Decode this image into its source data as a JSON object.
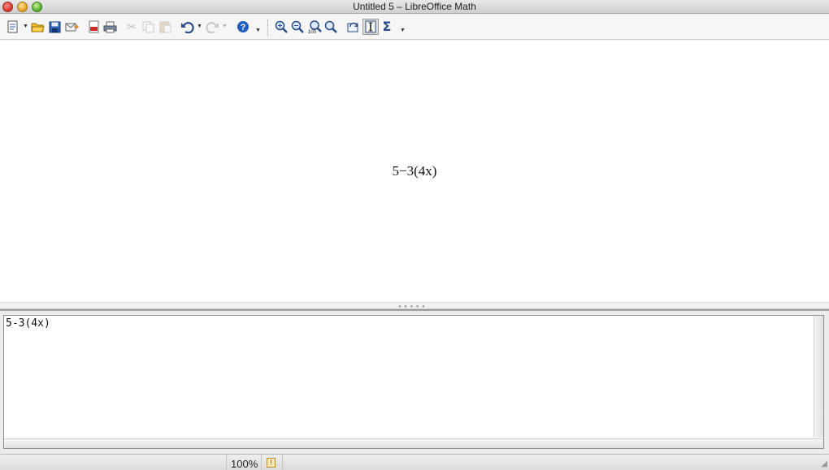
{
  "window": {
    "title": "Untitled 5 – LibreOffice Math"
  },
  "toolbar": {
    "buttons": [
      {
        "name": "new-document",
        "icon": "new-document-icon"
      },
      {
        "name": "open",
        "icon": "folder-open-icon"
      },
      {
        "name": "save",
        "icon": "floppy-disk-icon"
      },
      {
        "name": "email",
        "icon": "email-icon"
      },
      {
        "name": "export-pdf",
        "icon": "pdf-icon"
      },
      {
        "name": "print",
        "icon": "printer-icon"
      },
      {
        "name": "cut",
        "icon": "scissors-icon",
        "disabled": true
      },
      {
        "name": "copy",
        "icon": "copy-icon",
        "disabled": true
      },
      {
        "name": "paste",
        "icon": "paste-icon",
        "disabled": true
      },
      {
        "name": "undo",
        "icon": "undo-icon"
      },
      {
        "name": "redo",
        "icon": "redo-icon",
        "disabled": true
      },
      {
        "name": "help",
        "icon": "help-icon"
      },
      {
        "name": "zoom-in",
        "icon": "zoom-in-icon"
      },
      {
        "name": "zoom-out",
        "icon": "zoom-out-icon"
      },
      {
        "name": "zoom-100",
        "icon": "zoom-100-icon",
        "label": "100"
      },
      {
        "name": "show-all",
        "icon": "show-all-icon"
      },
      {
        "name": "update",
        "icon": "refresh-icon"
      },
      {
        "name": "formula-cursor",
        "icon": "text-cursor-icon",
        "active": true
      },
      {
        "name": "symbols",
        "icon": "sigma-icon"
      }
    ]
  },
  "preview": {
    "formula": "5−3(4x)"
  },
  "commands": {
    "text": "5-3(4x)"
  },
  "statusbar": {
    "zoom": "100%"
  },
  "colors": {
    "titlebar_top": "#e9e9e9",
    "titlebar_bottom": "#cfcfcf",
    "toolbar_bg": "#f6f6f6",
    "preview_bg": "#ffffff",
    "icon_blue": "#2a4d8a"
  }
}
